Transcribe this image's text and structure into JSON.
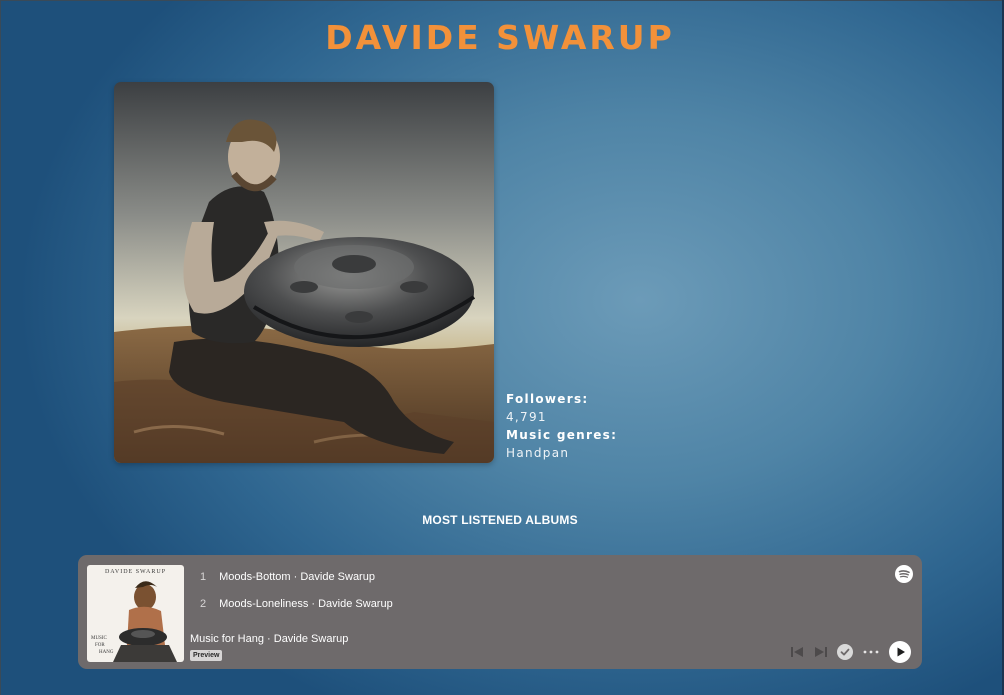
{
  "artist": {
    "name": "DAVIDE SWARUP",
    "photo_icon": "artist-photo-handpan-player",
    "followers_label": "Followers:",
    "followers_value": "4,791",
    "genres_label": "Music genres:",
    "genres_value": "Handpan"
  },
  "section": {
    "albums_title": "MOST LISTENED ALBUMS"
  },
  "player": {
    "tracks": [
      {
        "num": "1",
        "title": "Moods-Bottom · Davide Swarup"
      },
      {
        "num": "2",
        "title": "Moods-Loneliness · Davide Swarup"
      }
    ],
    "now_playing": "Music for Hang · Davide Swarup",
    "badge": "Preview",
    "album_art_text_top": "DAVIDE SWARUP",
    "album_art_text_bottom": "MUSIC FOR HANG",
    "icons": [
      "spotify-icon",
      "previous-icon",
      "next-icon",
      "saved-check-icon",
      "more-icon",
      "play-icon"
    ]
  },
  "colors": {
    "title": "#f2913a",
    "player_bg": "#6e6a6b",
    "background": "#4f84a6"
  }
}
